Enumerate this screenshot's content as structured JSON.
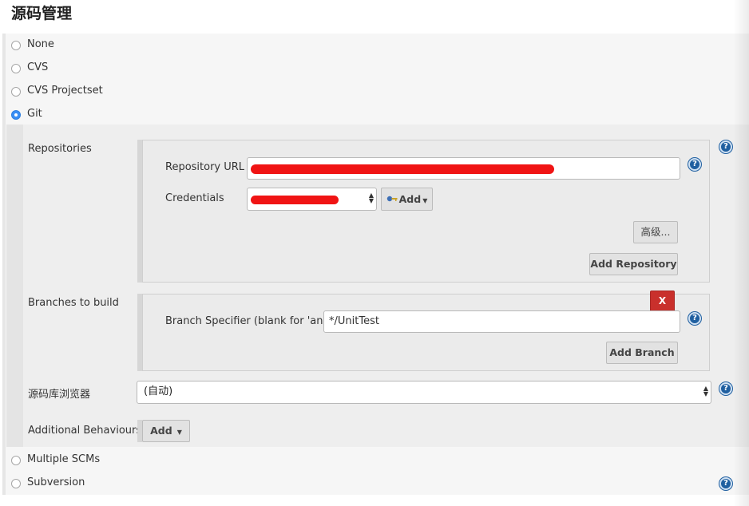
{
  "section": {
    "title": "源码管理"
  },
  "scm_options": [
    {
      "label": "None",
      "checked": false
    },
    {
      "label": "CVS",
      "checked": false
    },
    {
      "label": "CVS Projectset",
      "checked": false
    },
    {
      "label": "Git",
      "checked": true
    },
    {
      "label": "Multiple SCMs",
      "checked": false
    },
    {
      "label": "Subversion",
      "checked": false
    }
  ],
  "git": {
    "repositories_label": "Repositories",
    "repository_url_label": "Repository URL",
    "credentials_label": "Credentials",
    "credentials_add_label": "Add",
    "advanced_label": "高级...",
    "add_repository_label": "Add Repository",
    "branches_label": "Branches to build",
    "delete_label": "X",
    "branch_specifier_label": "Branch Specifier (blank for 'any')",
    "branch_specifier_value": "*/UnitTest",
    "add_branch_label": "Add Branch",
    "browser_label": "源码库浏览器",
    "browser_value": "(自动)",
    "additional_behaviours_label": "Additional Behaviours",
    "add_label": "Add"
  },
  "help_icon": {
    "glyph": "?"
  },
  "colors": {
    "accent": "#3a8ff5",
    "delete": "#c9302c",
    "redaction": "#f01414",
    "help": "#1f5fa0"
  }
}
